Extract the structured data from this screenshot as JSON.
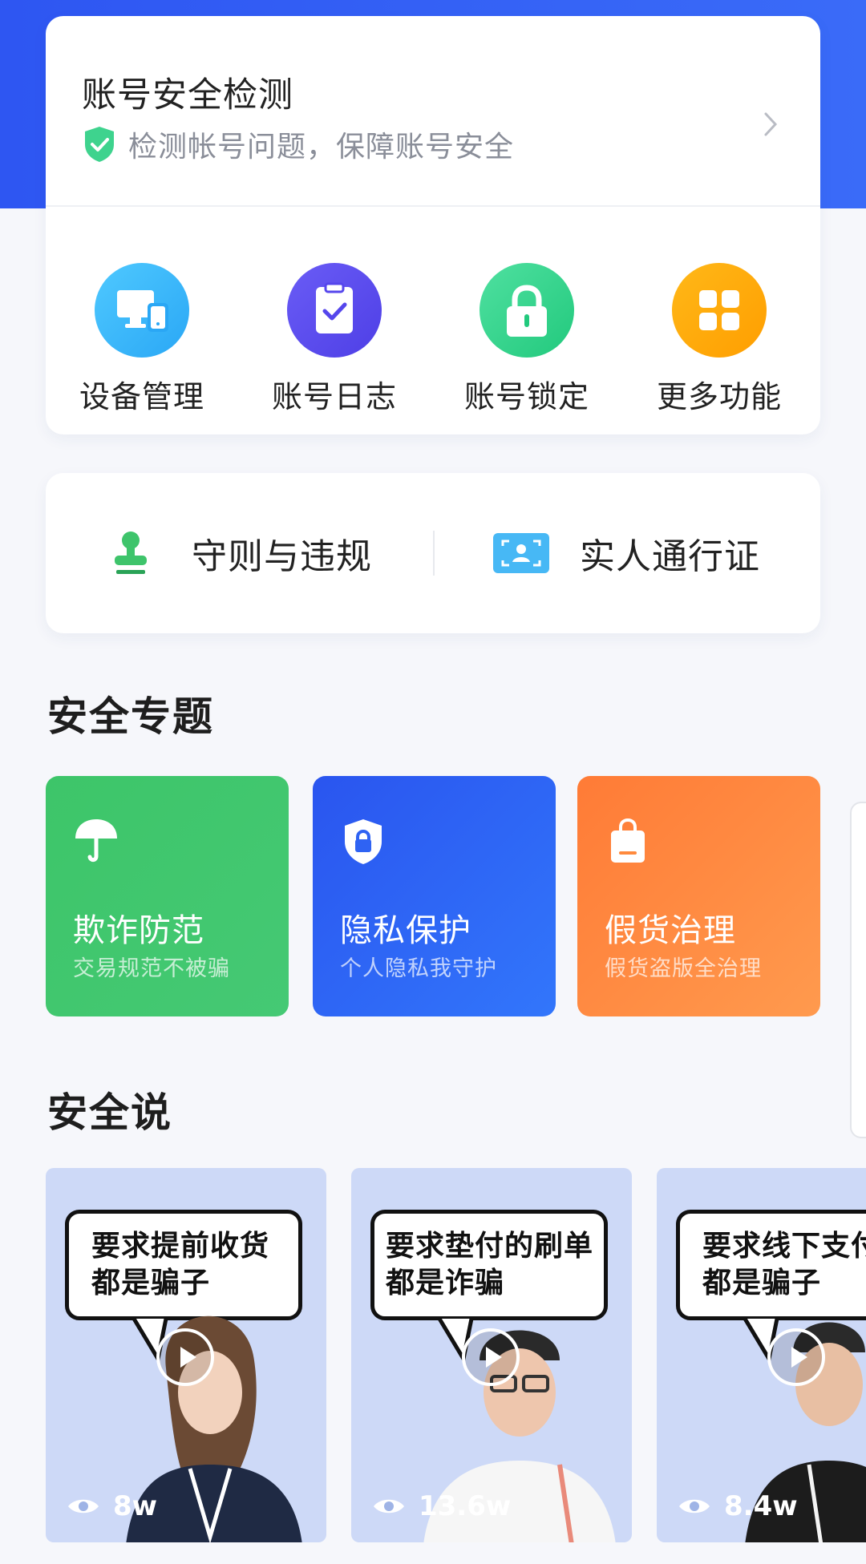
{
  "account_check": {
    "title": "账号安全检测",
    "subtitle": "检测帐号问题，保障账号安全"
  },
  "functions": [
    {
      "label": "设备管理",
      "icon": "device-icon",
      "color": "#33b8ff"
    },
    {
      "label": "账号日志",
      "icon": "clipboard-check-icon",
      "color": "#5f4ff0"
    },
    {
      "label": "账号锁定",
      "icon": "lock-icon",
      "color": "#2ed18c"
    },
    {
      "label": "更多功能",
      "icon": "grid-icon",
      "color": "#ffaa00"
    }
  ],
  "rules": [
    {
      "label": "守则与违规",
      "icon": "stamp-icon"
    },
    {
      "label": "实人通行证",
      "icon": "face-id-icon"
    }
  ],
  "topics_section": {
    "title": "安全专题",
    "items": [
      {
        "title": "欺诈防范",
        "subtitle": "交易规范不被骗",
        "icon": "umbrella-icon",
        "color": "#3ec46b"
      },
      {
        "title": "隐私保护",
        "subtitle": "个人隐私我守护",
        "icon": "shield-lock-icon",
        "color": "#2f63f3"
      },
      {
        "title": "假货治理",
        "subtitle": "假货盗版全治理",
        "icon": "bag-icon",
        "color": "#ff8a3d"
      }
    ]
  },
  "talk_section": {
    "title": "安全说",
    "videos": [
      {
        "caption": "要求提前收货\n都是骗子",
        "views": "8w"
      },
      {
        "caption": "要求垫付的刷单\n都是诈骗",
        "views": "13.6w"
      },
      {
        "caption": "要求线下支付\n都是骗子",
        "views": "8.4w"
      }
    ]
  }
}
